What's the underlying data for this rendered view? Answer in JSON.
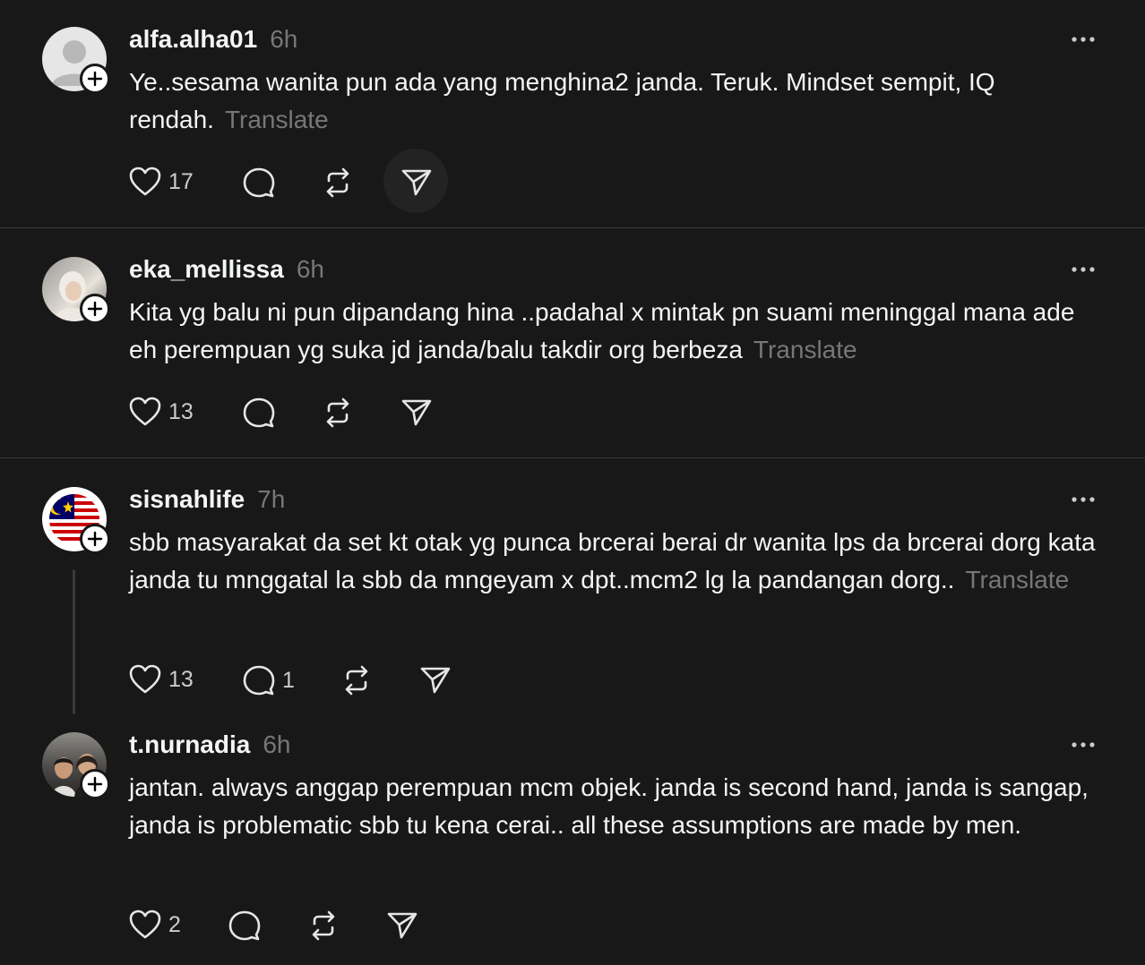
{
  "posts": [
    {
      "username": "alfa.alha01",
      "time": "6h",
      "text": "Ye..sesama wanita pun ada yang menghina2 janda. Teruk. Mindset sempit, IQ rendah.",
      "translate": "Translate",
      "likes": "17",
      "replies": "",
      "avatar": "default-avatar-icon"
    },
    {
      "username": "eka_mellissa",
      "time": "6h",
      "text": "Kita yg balu ni pun dipandang hina ..padahal x mintak pn suami meninggal mana ade eh perempuan yg suka jd janda/balu takdir org berbeza",
      "translate": "Translate",
      "likes": "13",
      "replies": "",
      "avatar": "photo-avatar"
    },
    {
      "username": "sisnahlife",
      "time": "7h",
      "text": "sbb masyarakat da set kt otak yg punca brcerai berai dr wanita lps da brcerai dorg kata janda tu mnggatal la sbb da mngeyam x dpt..mcm2 lg la pandangan dorg..",
      "translate": "Translate",
      "likes": "13",
      "replies": "1",
      "avatar": "malaysia-flag-avatar"
    },
    {
      "username": "t.nurnadia",
      "time": "6h",
      "text": "jantan. always anggap perempuan mcm objek. janda is second hand, janda is sangap, janda is problematic sbb tu kena cerai.. all these assumptions are made by men.",
      "translate": "",
      "likes": "2",
      "replies": "",
      "avatar": "photo-avatar"
    }
  ],
  "colors": {
    "background": "#181818",
    "text": "#f3f5f7",
    "muted": "#777777",
    "divider": "#383838"
  }
}
